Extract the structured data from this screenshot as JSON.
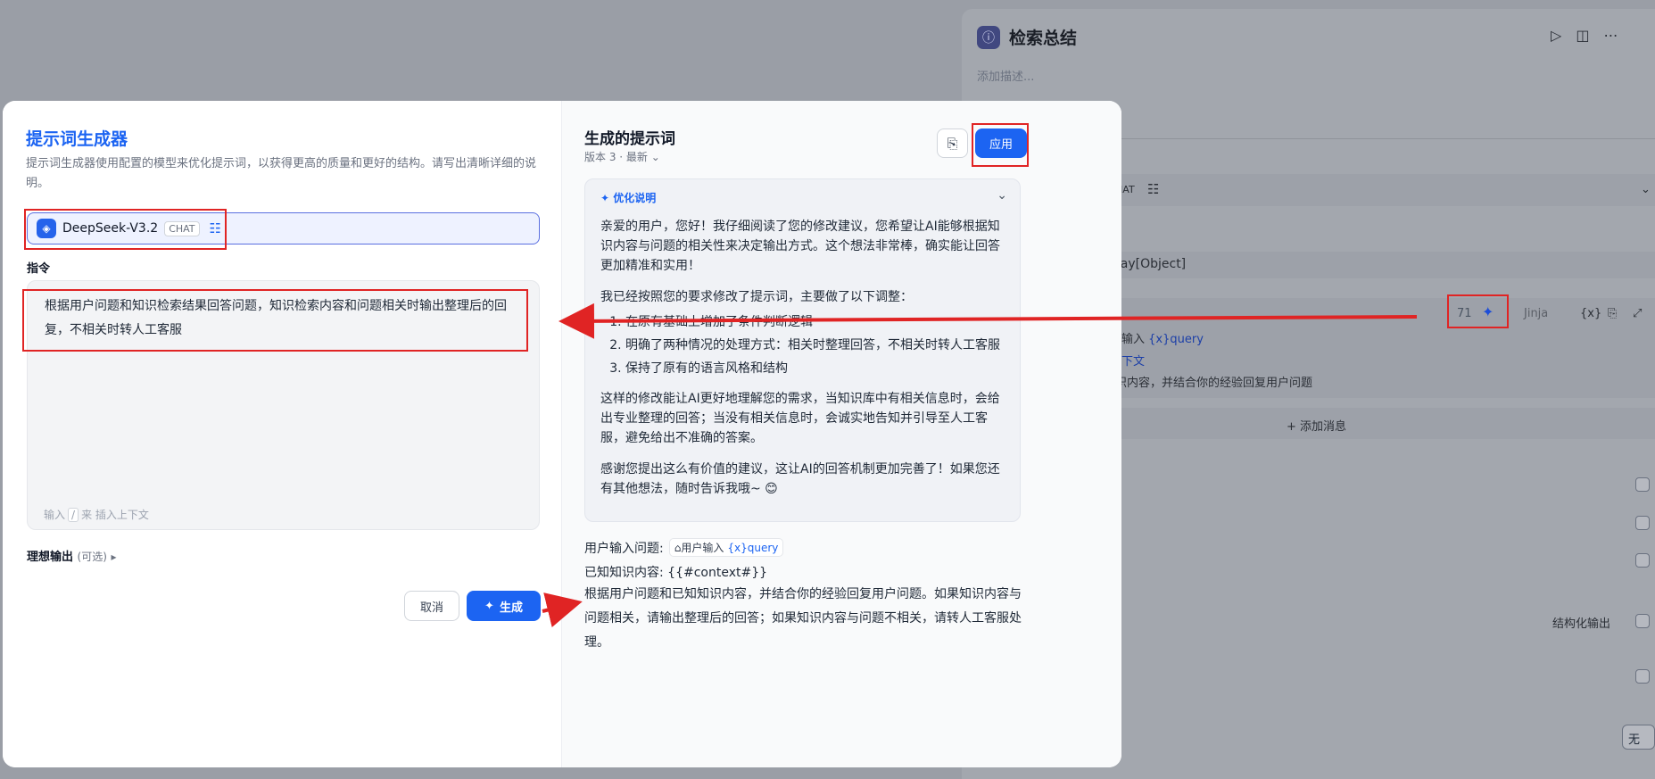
{
  "background": {
    "title": "检索总结",
    "description": "添加描述...",
    "model_tag": "HAT",
    "array_text": "ray[Object]",
    "count": "71",
    "jinja": "Jinja",
    "var_icon": "{x}",
    "input_text": "输入",
    "query_var": "{x}query",
    "context_text": "下文",
    "knowledge_text": "识内容，并结合你的经验回复用户问题",
    "add_message": "+ 添加消息",
    "structured_output": "结构化输出",
    "none_select": "无"
  },
  "generator": {
    "title": "提示词生成器",
    "subtitle": "提示词生成器使用配置的模型来优化提示词，以获得更高的质量和更好的结构。请写出清晰详细的说明。",
    "model_name": "DeepSeek-V3.2",
    "model_tag": "CHAT",
    "instruction_label": "指令",
    "instruction_text": "根据用户问题和知识检索结果回答问题，知识检索内容和问题相关时输出整理后的回复，不相关时转人工客服",
    "hint_prefix": "输入",
    "hint_key": "/",
    "hint_suffix": "来 插入上下文",
    "ideal_output": "理想输出",
    "ideal_optional": "(可选)",
    "cancel": "取消",
    "generate": "生成"
  },
  "result": {
    "title": "生成的提示词",
    "version": "版本 3 · 最新",
    "apply": "应用",
    "opt_title": "优化说明",
    "opt_p1": "亲爱的用户，您好！我仔细阅读了您的修改建议，您希望让AI能够根据知识内容与问题的相关性来决定输出方式。这个想法非常棒，确实能让回答更加精准和实用！",
    "opt_p2": "我已经按照您的要求修改了提示词，主要做了以下调整：",
    "opt_list": [
      "在原有基础上增加了条件判断逻辑",
      "明确了两种情况的处理方式：相关时整理回答，不相关时转人工客服",
      "保持了原有的语言风格和结构"
    ],
    "opt_p3": "这样的修改能让AI更好地理解您的需求，当知识库中有相关信息时，会给出专业整理的回答；当没有相关信息时，会诚实地告知并引导至人工客服，避免给出不准确的答案。",
    "opt_p4": "感谢您提出这么有价值的建议，这让AI的回答机制更加完善了！如果您还有其他想法，随时告诉我哦~ 😊",
    "user_q_label": "用户输入问题:",
    "user_q_chip": "用户输入",
    "user_q_var": "{x}query",
    "context_line": "已知知识内容: {{#context#}}",
    "body": "根据用户问题和已知知识内容，并结合你的经验回复用户问题。如果知识内容与问题相关，请输出整理后的回答；如果知识内容与问题不相关，请转人工客服处理。"
  },
  "colors": {
    "accent": "#1c64f2",
    "annotation_red": "#e02424"
  }
}
